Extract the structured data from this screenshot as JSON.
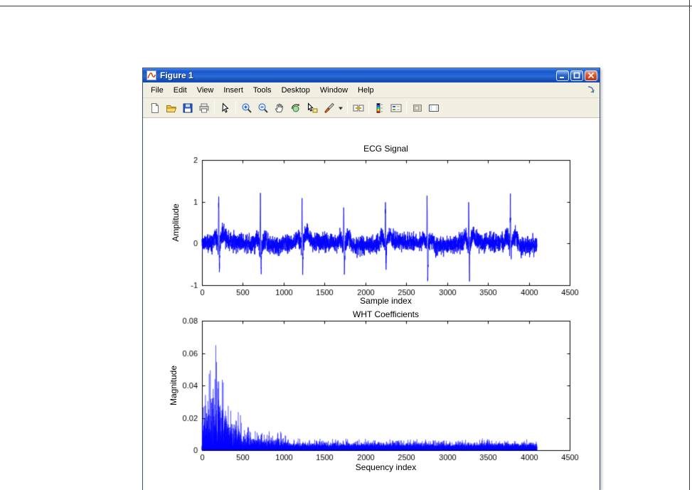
{
  "window": {
    "title": "Figure 1",
    "menu_items": [
      "File",
      "Edit",
      "View",
      "Insert",
      "Tools",
      "Desktop",
      "Window",
      "Help"
    ],
    "toolbar_icons": [
      "new-figure",
      "open-file",
      "save-figure",
      "print-figure",
      "edit-plot",
      "zoom-in",
      "zoom-out",
      "pan",
      "rotate-3d",
      "data-cursor",
      "brush",
      "brush-dropdown",
      "link-plots",
      "insert-colorbar",
      "insert-legend",
      "hide-plot-tools",
      "show-plot-tools"
    ],
    "accent_colors": {
      "titlebar_blue": "#1a57c8",
      "close_red": "#e0532d",
      "chrome_tan": "#f1efe2"
    }
  },
  "chart_data": [
    {
      "type": "line",
      "title": "ECG Signal",
      "xlabel": "Sample index",
      "ylabel": "Amplitude",
      "xlim": [
        0,
        4500
      ],
      "ylim": [
        -1,
        2
      ],
      "xticks": [
        0,
        500,
        1000,
        1500,
        2000,
        2500,
        3000,
        3500,
        4000,
        4500
      ],
      "yticks": [
        -1,
        0,
        1,
        2
      ],
      "line_color": "#0000ff",
      "grid": false,
      "signal": {
        "kind": "ecg",
        "n": 4100,
        "seed": 11,
        "beat_period": 510,
        "first_beat": 205,
        "baseline_noise": 0.11,
        "r_peak": [
          0.95,
          1.25
        ],
        "s_depth": [
          -0.3,
          -0.95
        ],
        "description": "Noisy ECG trace, 8 QRS complexes near samples 205,715,...,3775, R peaks ~1.1-1.25, deep S dips to ~-1, baseline noise band ~±0.35"
      }
    },
    {
      "type": "line",
      "title": "WHT Coefficients",
      "xlabel": "Sequency index",
      "ylabel": "Magnitude",
      "xlim": [
        0,
        4500
      ],
      "ylim": [
        0,
        0.08
      ],
      "xticks": [
        0,
        500,
        1000,
        1500,
        2000,
        2500,
        3000,
        3500,
        4000,
        4500
      ],
      "yticks": [
        0,
        0.02,
        0.04,
        0.06,
        0.08
      ],
      "line_color": "#0000ff",
      "grid": false,
      "signal": {
        "kind": "wht",
        "n": 4100,
        "seed": 29,
        "tall_spike_prob": 0.07,
        "envelope": [
          [
            0,
            0.03
          ],
          [
            80,
            0.05
          ],
          [
            150,
            0.065
          ],
          [
            230,
            0.058
          ],
          [
            300,
            0.032
          ],
          [
            430,
            0.028
          ],
          [
            520,
            0.014
          ],
          [
            700,
            0.009
          ],
          [
            950,
            0.01
          ],
          [
            1080,
            0.005
          ],
          [
            1600,
            0.0045
          ],
          [
            2500,
            0.0045
          ],
          [
            4100,
            0.0045
          ]
        ],
        "description": "Walsh-Hadamard magnitudes: tall spikes up to ~0.065 below sequency 500, decaying to dense low band ~0.002-0.006 out to 4100"
      }
    }
  ]
}
